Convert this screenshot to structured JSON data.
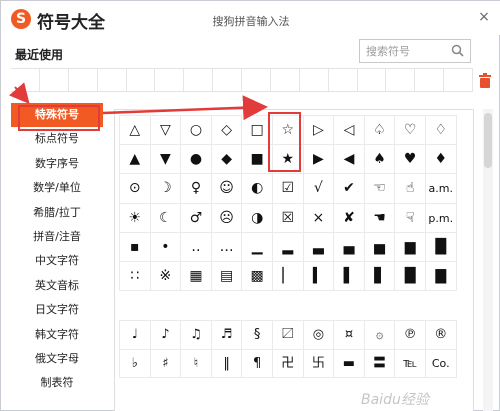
{
  "app": {
    "title": "符号大全",
    "window_title": "搜狗拼音输入法",
    "logo_letter": "S",
    "brand_color": "#f15a22"
  },
  "controls": {
    "close": "×"
  },
  "recent": {
    "label": "最近使用",
    "slots": 16
  },
  "search": {
    "placeholder": "搜索符号"
  },
  "sidebar": {
    "items": [
      "特殊符号",
      "标点符号",
      "数字序号",
      "数学/单位",
      "希腊/拉丁",
      "拼音/注音",
      "中文字符",
      "英文音标",
      "日文字符",
      "韩文字符",
      "俄文字母",
      "制表符"
    ],
    "active_index": 0
  },
  "symbols": {
    "rows": [
      [
        "△",
        "▽",
        "○",
        "◇",
        "□",
        "☆",
        "▷",
        "◁",
        "♤",
        "♡"
      ],
      [
        "▲",
        "▼",
        "●",
        "◆",
        "■",
        "★",
        "▶",
        "◀",
        "♠",
        "♥"
      ],
      [
        "⊙",
        "☽",
        "♀",
        "☺",
        "◐",
        "☑",
        "√",
        "✔",
        "☜",
        "☝"
      ],
      [
        "☀",
        "☾",
        "♂",
        "☹",
        "◑",
        "☒",
        "×",
        "✘",
        "☚",
        "☟"
      ],
      [
        "▪",
        "•",
        "‥",
        "…",
        "▁",
        "▂",
        "▃",
        "▄",
        "▅",
        "▆"
      ],
      [
        "∷",
        "※",
        "▦",
        "▤",
        "▩",
        "▏",
        "▍",
        "▌",
        "▋",
        "█"
      ]
    ],
    "rows2": [
      [
        "♩",
        "♪",
        "♫",
        "♬",
        "§",
        "〼",
        "◎",
        "¤",
        "۞",
        "℗"
      ],
      [
        "♭",
        "♯",
        "♮",
        "‖",
        "¶",
        "卍",
        "卐",
        "▬",
        "〓",
        "℡"
      ]
    ],
    "extra_col_top": [
      "♢",
      "♦",
      "a.m.",
      "p.m.",
      "█",
      "▇"
    ],
    "extra_col_bottom": [
      "®",
      "Co."
    ],
    "highlighted": [
      "☆",
      "★"
    ]
  },
  "watermark": "Baidu经验"
}
